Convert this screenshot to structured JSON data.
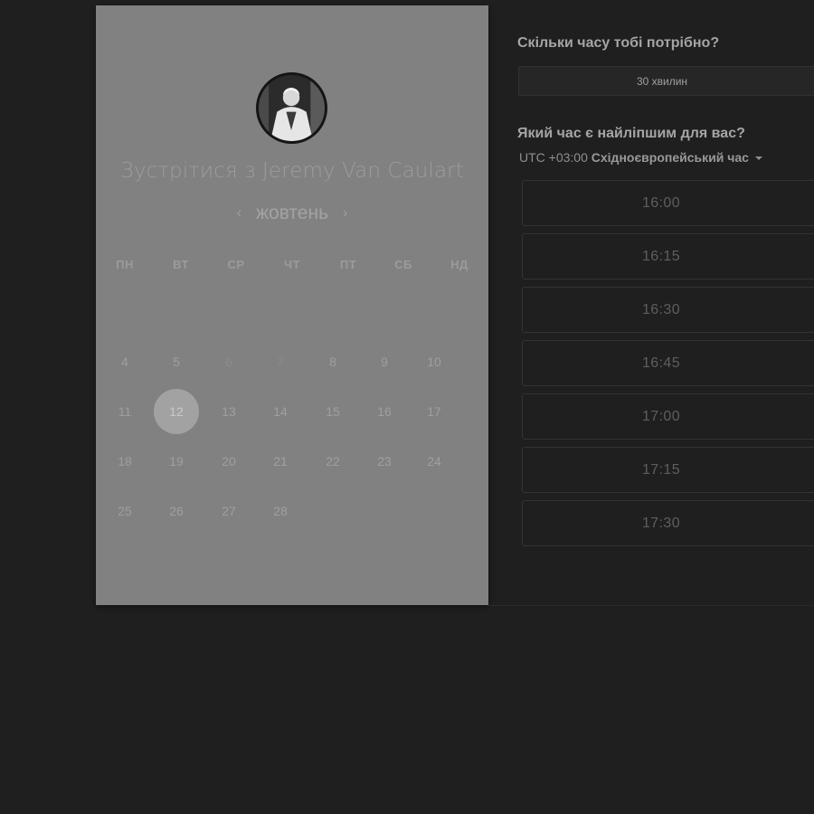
{
  "left_card": {
    "title_prefix": "Зустрітися з",
    "host_name": "Jeremy Van Caulart",
    "month": "жовтень",
    "prev_month_icon": "chevron-left-icon",
    "next_month_icon": "chevron-right-icon",
    "weekdays": [
      "ПН",
      "ВТ",
      "СР",
      "ЧТ",
      "ПТ",
      "СБ",
      "НД"
    ],
    "days": [
      {
        "label": "4"
      },
      {
        "label": "5"
      },
      {
        "label": "6"
      },
      {
        "label": "7"
      },
      {
        "label": "8"
      },
      {
        "label": "9"
      },
      {
        "label": "10"
      },
      {
        "label": "11"
      },
      {
        "label": "12"
      },
      {
        "label": "13"
      },
      {
        "label": "14"
      },
      {
        "label": "15"
      },
      {
        "label": "16"
      },
      {
        "label": "17"
      },
      {
        "label": "18"
      },
      {
        "label": "19"
      },
      {
        "label": "20"
      },
      {
        "label": "21"
      },
      {
        "label": "22"
      },
      {
        "label": "23"
      },
      {
        "label": "24"
      },
      {
        "label": "25"
      },
      {
        "label": "26"
      },
      {
        "label": "27"
      },
      {
        "label": "28"
      }
    ],
    "selected_day": "12"
  },
  "right_panel": {
    "duration_question": "Скільки часу тобі потрібно?",
    "duration_value": "30 хвилин",
    "time_question": "Який час є найліпшим для вас?",
    "timezone_offset": "UTC +03:00",
    "timezone_name": "Східноєвропейський час",
    "time_slots": [
      "16:00",
      "16:15",
      "16:30",
      "16:45",
      "17:00",
      "17:15",
      "17:30"
    ]
  },
  "colors": {
    "page_background": "#1f1f1f",
    "card_background": "#818181",
    "selected_day": "#a2a2a2"
  }
}
